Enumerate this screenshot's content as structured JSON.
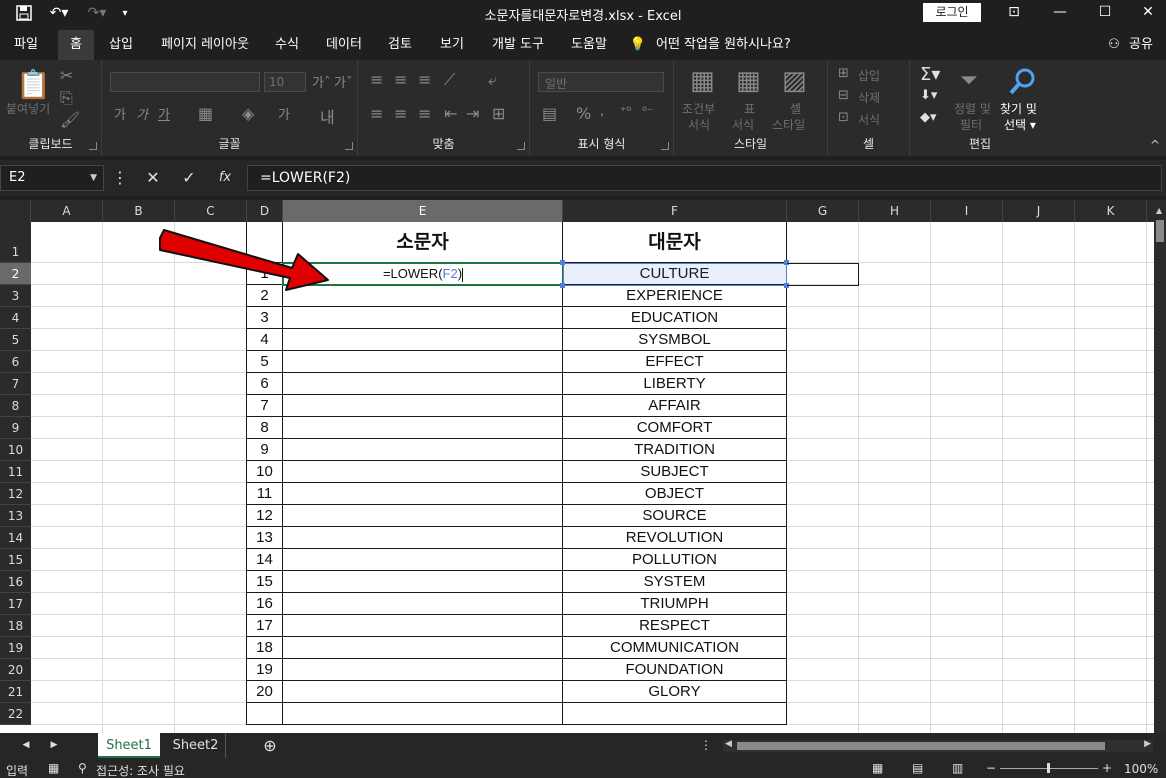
{
  "window": {
    "title": "소문자를대문자로변경.xlsx  -  Excel",
    "login_label": "로그인"
  },
  "ribbon_tabs": [
    "파일",
    "홈",
    "삽입",
    "페이지 레이아웃",
    "수식",
    "데이터",
    "검토",
    "보기",
    "개발 도구",
    "도움말",
    "어떤 작업을 원하시나요?"
  ],
  "share_label": "공유",
  "ribbon": {
    "clipboard": {
      "label": "클립보드",
      "paste": "붙여넣기"
    },
    "font": {
      "label": "글꼴",
      "size": "10"
    },
    "align": {
      "label": "맞춤"
    },
    "number": {
      "label": "표시 형식",
      "format": "일반"
    },
    "style": {
      "label": "스타일",
      "cond": "조건부",
      "cond2": "서식",
      "table": "표",
      "table2": "서식",
      "cell": "셀",
      "cell2": "스타일"
    },
    "cells": {
      "label": "셀",
      "insert": "삽입",
      "delete": "삭제",
      "format": "서식"
    },
    "edit": {
      "label": "편집",
      "sort": "정렬 및",
      "sort2": "필터",
      "find": "찾기 및",
      "find2": "선택"
    }
  },
  "formula_bar": {
    "name_box": "E2",
    "formula": "=LOWER(F2)"
  },
  "columns": [
    "A",
    "B",
    "C",
    "D",
    "E",
    "F",
    "G",
    "H",
    "I",
    "J",
    "K"
  ],
  "rows": [
    "1",
    "2",
    "3",
    "4",
    "5",
    "6",
    "7",
    "8",
    "9",
    "10",
    "11",
    "12",
    "13",
    "14",
    "15",
    "16",
    "17",
    "18",
    "19",
    "20",
    "21",
    "22"
  ],
  "table": {
    "header_lower": "소문자",
    "header_upper": "대문자",
    "edit_prefix": "=LOWER(",
    "edit_ref": "F2",
    "edit_suffix": ")",
    "numbers": [
      "1",
      "2",
      "3",
      "4",
      "5",
      "6",
      "7",
      "8",
      "9",
      "10",
      "11",
      "12",
      "13",
      "14",
      "15",
      "16",
      "17",
      "18",
      "19",
      "20"
    ],
    "words": [
      "CULTURE",
      "EXPERIENCE",
      "EDUCATION",
      "SYSMBOL",
      "EFFECT",
      "LIBERTY",
      "AFFAIR",
      "COMFORT",
      "TRADITION",
      "SUBJECT",
      "OBJECT",
      "SOURCE",
      "REVOLUTION",
      "POLLUTION",
      "SYSTEM",
      "TRIUMPH",
      "RESPECT",
      "COMMUNICATION",
      "FOUNDATION",
      "GLORY"
    ]
  },
  "sheets": [
    "Sheet1",
    "Sheet2"
  ],
  "status": {
    "mode": "입력",
    "accessibility": "접근성: 조사 필요",
    "zoom": "100%"
  },
  "colors": {
    "accent": "#217346",
    "selection": "#4e7fd9",
    "arrow": "#e00000"
  }
}
